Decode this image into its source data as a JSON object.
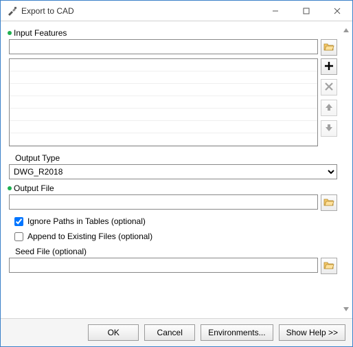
{
  "window": {
    "title": "Export to CAD"
  },
  "fields": {
    "input_features": {
      "label": "Input Features",
      "value": ""
    },
    "output_type": {
      "label": "Output Type",
      "selected": "DWG_R2018",
      "options": [
        "DWG_R2018"
      ]
    },
    "output_file": {
      "label": "Output File",
      "value": ""
    },
    "ignore_paths": {
      "label": "Ignore Paths in Tables (optional)",
      "checked": true
    },
    "append_existing": {
      "label": "Append to Existing Files (optional)",
      "checked": false
    },
    "seed_file": {
      "label": "Seed File (optional)",
      "value": ""
    }
  },
  "buttons": {
    "ok": "OK",
    "cancel": "Cancel",
    "environments": "Environments...",
    "show_help": "Show Help >>"
  }
}
